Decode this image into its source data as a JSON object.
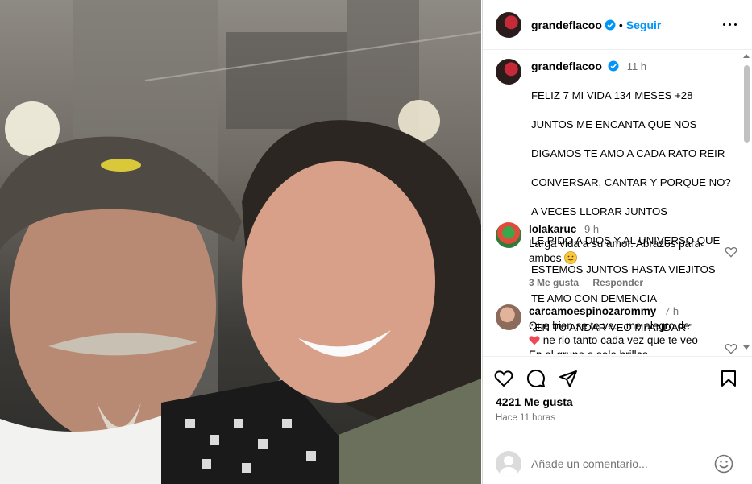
{
  "post": {
    "username": "grandeflacoo",
    "follow_label": "Seguir",
    "dot": "•",
    "caption_time": "11 h",
    "caption_lines": [
      "FELIZ 7 MI VIDA 134 MESES +28",
      "JUNTOS ME ENCANTA QUE NOS",
      "DIGAMOS TE AMO A CADA RATO REIR",
      "CONVERSAR, CANTAR Y PORQUE NO?",
      "A VECES LLORAR JUNTOS",
      "LE PIDO A DIOS Y AL UNIVERSO QUE",
      "ESTEMOS JUNTOS HASTA VIEJITOS",
      "TE AMO CON DEMENCIA",
      "\"EN TU ANDAR VEO MI ANDAR \""
    ]
  },
  "comments": [
    {
      "username": "lolakaruc",
      "time": "9 h",
      "text_line1": "Larga vida a su amor. Abrazos para",
      "text_line2": "ambos",
      "likes": "3 Me gusta",
      "reply": "Responder"
    },
    {
      "username": "carcamoespinozarommy",
      "time": "7 h",
      "text_line1": "Que bien se te ve....me alegro de",
      "text_line2": "ne rio tanto cada vez que te veo",
      "text_line3": "En el grupo o solo brillas"
    }
  ],
  "footer": {
    "likes": "4221 Me gusta",
    "ago": "Hace 11 horas",
    "comment_placeholder": "Añade un comentario..."
  },
  "colors": {
    "link": "#0095f6",
    "verified": "#0095f6",
    "secondary_text": "#737373",
    "heart_emoji": "#ed4956"
  }
}
